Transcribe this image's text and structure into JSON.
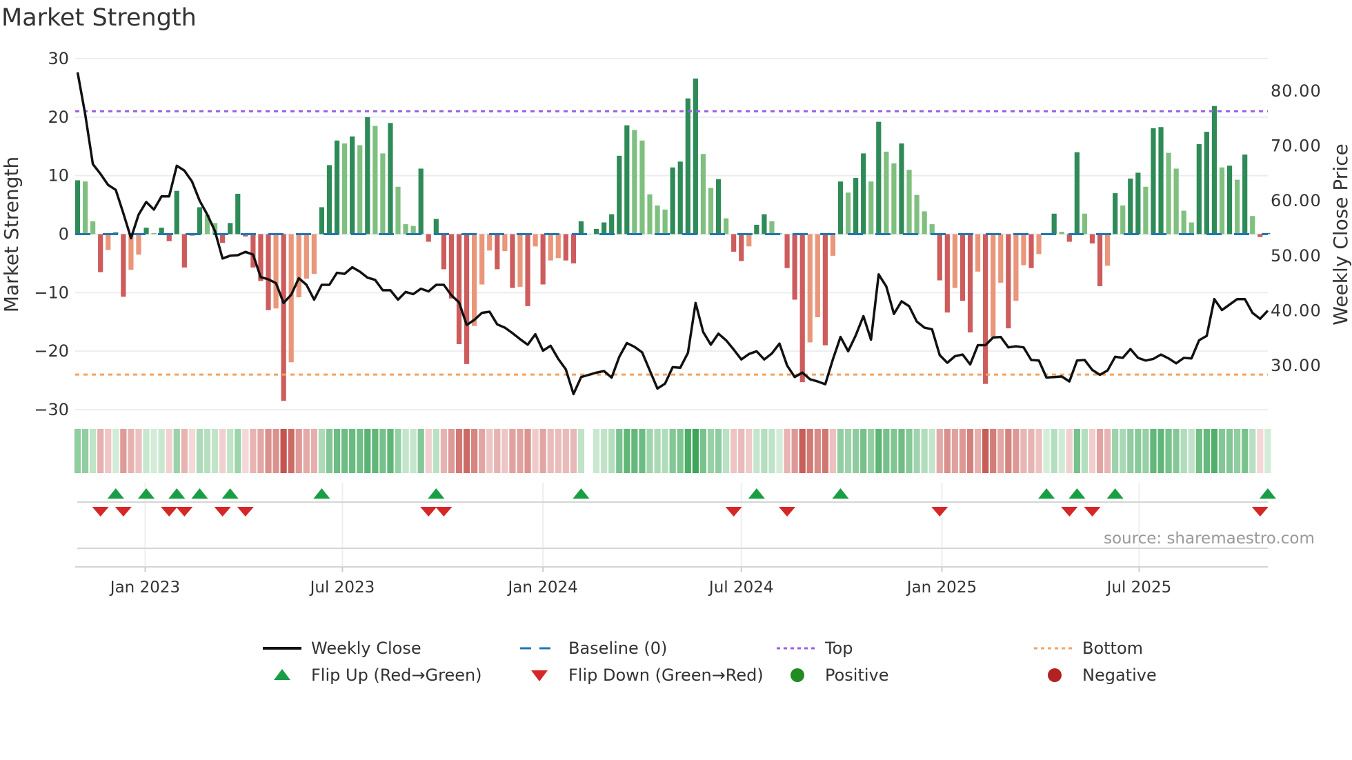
{
  "title": "Market Strength",
  "source_note": "source: sharemaestro.com",
  "chart_data": {
    "type": "bar",
    "title": "Market Strength",
    "ylabel": "Market Strength",
    "y2label": "Weekly Close Price",
    "ylim": [
      -30,
      30
    ],
    "y2lim": [
      22,
      86
    ],
    "yticks": [
      30,
      20,
      10,
      0,
      -10,
      -20,
      -30
    ],
    "ytick_labels": [
      "30",
      "20",
      "10",
      "0",
      "−10",
      "−20",
      "−30"
    ],
    "y2ticks": [
      80,
      70,
      60,
      50,
      40,
      30
    ],
    "y2tick_labels": [
      "80.00",
      "70.00",
      "60.00",
      "50.00",
      "40.00",
      "30.00"
    ],
    "x_start": "2022-10-31",
    "x_interval_days": 7,
    "xticks": [
      "2023-01-01",
      "2023-07-01",
      "2024-01-01",
      "2024-07-01",
      "2025-01-01",
      "2025-07-01"
    ],
    "xtick_labels": [
      "Jan 2023",
      "Jul 2023",
      "Jan 2024",
      "Jul 2024",
      "Jan 2025",
      "Jul 2025"
    ],
    "grid": true,
    "top_threshold": 21,
    "bottom_threshold": -24,
    "baseline": 0,
    "strength": [
      9.2,
      9.0,
      2.2,
      -6.5,
      -2.7,
      0.3,
      -10.7,
      -6.1,
      -3.5,
      1.1,
      0.2,
      1.1,
      -1.2,
      7.4,
      -5.7,
      -0.3,
      4.6,
      3.3,
      1.9,
      -1.5,
      1.9,
      6.9,
      -0.4,
      -5.7,
      -8.0,
      -13.0,
      -12.7,
      -28.5,
      -21.9,
      -10.8,
      -7.6,
      -6.8,
      4.6,
      11.8,
      16.0,
      15.5,
      16.7,
      15.2,
      20.0,
      18.5,
      13.8,
      19.0,
      8.1,
      1.7,
      1.4,
      11.2,
      -1.3,
      2.6,
      -6.0,
      -11.0,
      -18.8,
      -22.2,
      -15.7,
      -8.6,
      -2.8,
      -6.0,
      -2.9,
      -9.2,
      -9.0,
      -12.3,
      -2.1,
      -8.6,
      -4.5,
      -4.1,
      -4.5,
      -5.0,
      2.2,
      0,
      0.9,
      2.0,
      3.4,
      13.4,
      18.6,
      17.8,
      16.0,
      6.8,
      4.9,
      4.2,
      11.4,
      12.4,
      23.2,
      26.6,
      13.7,
      7.9,
      9.4,
      2.7,
      -3.0,
      -4.6,
      -2.1,
      1.6,
      3.4,
      2.2,
      0.2,
      -5.8,
      -11.2,
      -25.3,
      -18.5,
      -14.2,
      -19.0,
      -3.7,
      9.0,
      7.1,
      9.6,
      13.8,
      9.0,
      19.2,
      14.1,
      12.1,
      15.5,
      11.0,
      6.7,
      3.9,
      1.7,
      -7.9,
      -13.4,
      -9.2,
      -11.4,
      -16.8,
      -6.4,
      -25.6,
      -17.6,
      -8.3,
      -16.1,
      -11.4,
      -5.3,
      -5.8,
      -3.4,
      0.1,
      3.5,
      0.4,
      -1.3,
      14.0,
      3.5,
      -1.6,
      -8.9,
      -5.4,
      7.0,
      4.9,
      9.5,
      10.5,
      8.1,
      18.1,
      18.3,
      13.9,
      11.2,
      4.0,
      2.0,
      15.4,
      17.5,
      21.9,
      11.4,
      11.7,
      9.3,
      13.6,
      3.1,
      -0.5,
      0.2
    ],
    "weekly_close": [
      83.4,
      75.7,
      66.7,
      64.9,
      62.9,
      62.0,
      57.7,
      53.2,
      57.5,
      59.8,
      58.4,
      60.8,
      60.8,
      66.4,
      65.5,
      63.5,
      60.0,
      57.5,
      54.5,
      49.5,
      50.0,
      50.1,
      50.7,
      50.2,
      46.1,
      45.7,
      45.0,
      41.4,
      42.9,
      45.9,
      44.7,
      42.0,
      44.7,
      44.7,
      46.9,
      46.7,
      47.9,
      47.1,
      46.0,
      45.6,
      43.7,
      43.7,
      42.0,
      43.4,
      43.0,
      44.0,
      43.5,
      44.7,
      44.7,
      42.8,
      41.5,
      37.4,
      38.3,
      39.6,
      39.8,
      37.5,
      36.9,
      35.9,
      34.8,
      33.8,
      35.7,
      32.7,
      33.6,
      31.2,
      29.3,
      24.8,
      27.9,
      28.3,
      28.7,
      29.0,
      27.8,
      31.6,
      34.1,
      33.4,
      32.4,
      29.1,
      25.8,
      26.7,
      29.7,
      29.6,
      32.3,
      41.4,
      36.1,
      33.8,
      35.8,
      34.6,
      32.9,
      31.1,
      32.1,
      32.6,
      31.1,
      32.2,
      34.0,
      30.0,
      27.9,
      28.7,
      27.5,
      27.1,
      26.6,
      31.1,
      35.2,
      32.6,
      35.5,
      39.0,
      34.7,
      46.6,
      44.4,
      39.4,
      41.7,
      40.8,
      38.0,
      36.9,
      36.6,
      31.9,
      30.5,
      31.7,
      32.0,
      30.2,
      33.7,
      33.7,
      35.1,
      35.2,
      33.3,
      33.5,
      33.3,
      31.0,
      30.9,
      27.8,
      27.9,
      28.0,
      27.1,
      30.9,
      31.0,
      29.2,
      28.3,
      29.1,
      31.6,
      31.4,
      33.0,
      31.4,
      30.9,
      31.2,
      32.0,
      31.3,
      30.4,
      31.4,
      31.3,
      34.6,
      35.4,
      42.1,
      40.1,
      41.1,
      42.1,
      42.1,
      39.6,
      38.5,
      40.0
    ],
    "flip_up_week_index": [
      5,
      9,
      13,
      16,
      20,
      32,
      47,
      66,
      89,
      100,
      127,
      131,
      136,
      156
    ],
    "flip_down_week_index": [
      3,
      6,
      12,
      14,
      19,
      22,
      46,
      48,
      86,
      93,
      113,
      130,
      133,
      155
    ],
    "legend": [
      {
        "label": "Weekly Close",
        "kind": "line"
      },
      {
        "label": "Baseline (0)",
        "kind": "dash"
      },
      {
        "label": "Top",
        "kind": "dot-purple"
      },
      {
        "label": "Bottom",
        "kind": "dot-orange"
      },
      {
        "label": "Flip Up (Red→Green)",
        "kind": "triangle-up"
      },
      {
        "label": "Flip Down (Green→Red)",
        "kind": "triangle-down"
      },
      {
        "label": "Positive",
        "kind": "circle-green"
      },
      {
        "label": "Negative",
        "kind": "circle-red"
      }
    ],
    "legend_placement": "bottom",
    "colors": {
      "pos_strong": "#2e8b57",
      "pos_weak": "#7fbf7f",
      "neg_strong": "#cd5c5c",
      "neg_weak": "#e9967a",
      "close": "#111111",
      "baseline": "#1f77b4",
      "top": "#9b5de5",
      "bottom": "#f4a261",
      "flip_up": "#1a9e45",
      "flip_down": "#d62728",
      "positive": "#228b22",
      "negative": "#b22222",
      "source": "#999999"
    }
  }
}
